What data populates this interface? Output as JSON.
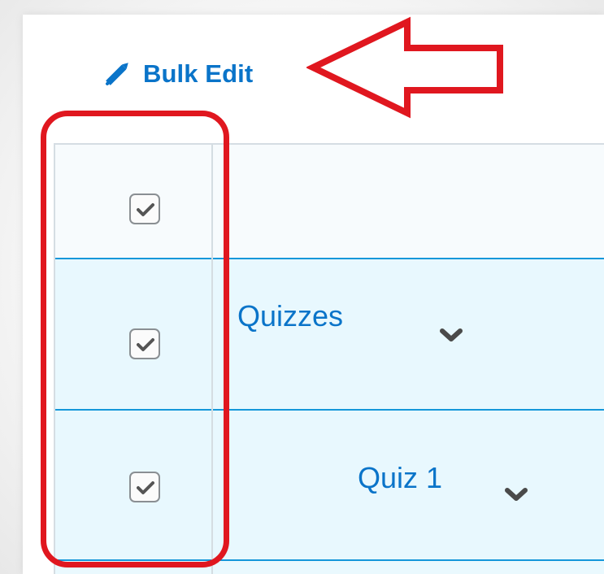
{
  "toolbar": {
    "bulk_edit_label": "Bulk Edit",
    "pencil_icon": "pencil-icon"
  },
  "rows": [
    {
      "label": "",
      "checked": true
    },
    {
      "label": "Quizzes",
      "checked": true,
      "chevron": "chevron-down-icon"
    },
    {
      "label": "Quiz 1",
      "checked": true,
      "chevron": "chevron-down-icon"
    }
  ],
  "annotations": {
    "arrow_color": "#e0171f",
    "highlight_color": "#e0171f"
  },
  "colors": {
    "accent": "#0a74c9",
    "row_border": "#1597da",
    "selected_row_background": "#e8f8fe"
  }
}
